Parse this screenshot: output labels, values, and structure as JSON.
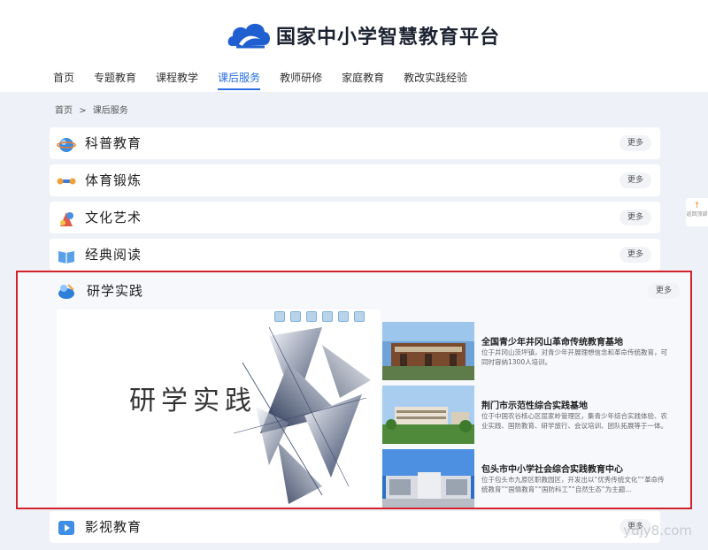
{
  "header": {
    "title": "国家中小学智慧教育平台",
    "nav": [
      "首页",
      "专题教育",
      "课程教学",
      "课后服务",
      "教师研修",
      "家庭教育",
      "教改实践经验"
    ],
    "active_nav": "课后服务"
  },
  "breadcrumb": {
    "home": "首页",
    "sep": ">",
    "current": "课后服务"
  },
  "more_label": "更多",
  "sections": [
    {
      "title": "科普教育",
      "icon": "science-icon"
    },
    {
      "title": "体育锻炼",
      "icon": "sports-icon"
    },
    {
      "title": "文化艺术",
      "icon": "art-icon"
    },
    {
      "title": "经典阅读",
      "icon": "book-icon"
    },
    {
      "title": "研学实践",
      "icon": "research-icon"
    },
    {
      "title": "影视教育",
      "icon": "film-icon"
    }
  ],
  "banner": {
    "text": "研学实践"
  },
  "items": [
    {
      "title": "全国青少年井冈山革命传统教育基地",
      "desc": "位于井冈山茨坪镇，对青少年开展理想信念和革命传统教育，可同时容纳1300人培训。"
    },
    {
      "title": "荆门市示范性综合实践基地",
      "desc": "位于中国农谷核心区屈家岭管理区，集青少年综合实践体验、农业实践、国防教育、研学旅行、会议培训、团队拓展等于一体。"
    },
    {
      "title": "包头市中小学社会综合实践教育中心",
      "desc": "位于包头市九原区职教园区，开发出以“优秀传统文化”“革命传统教育”“国情教育”“国防科工”“自然生态”为主题..."
    }
  ],
  "side_tab": "返回顶部",
  "watermark": "ydjy8.com"
}
